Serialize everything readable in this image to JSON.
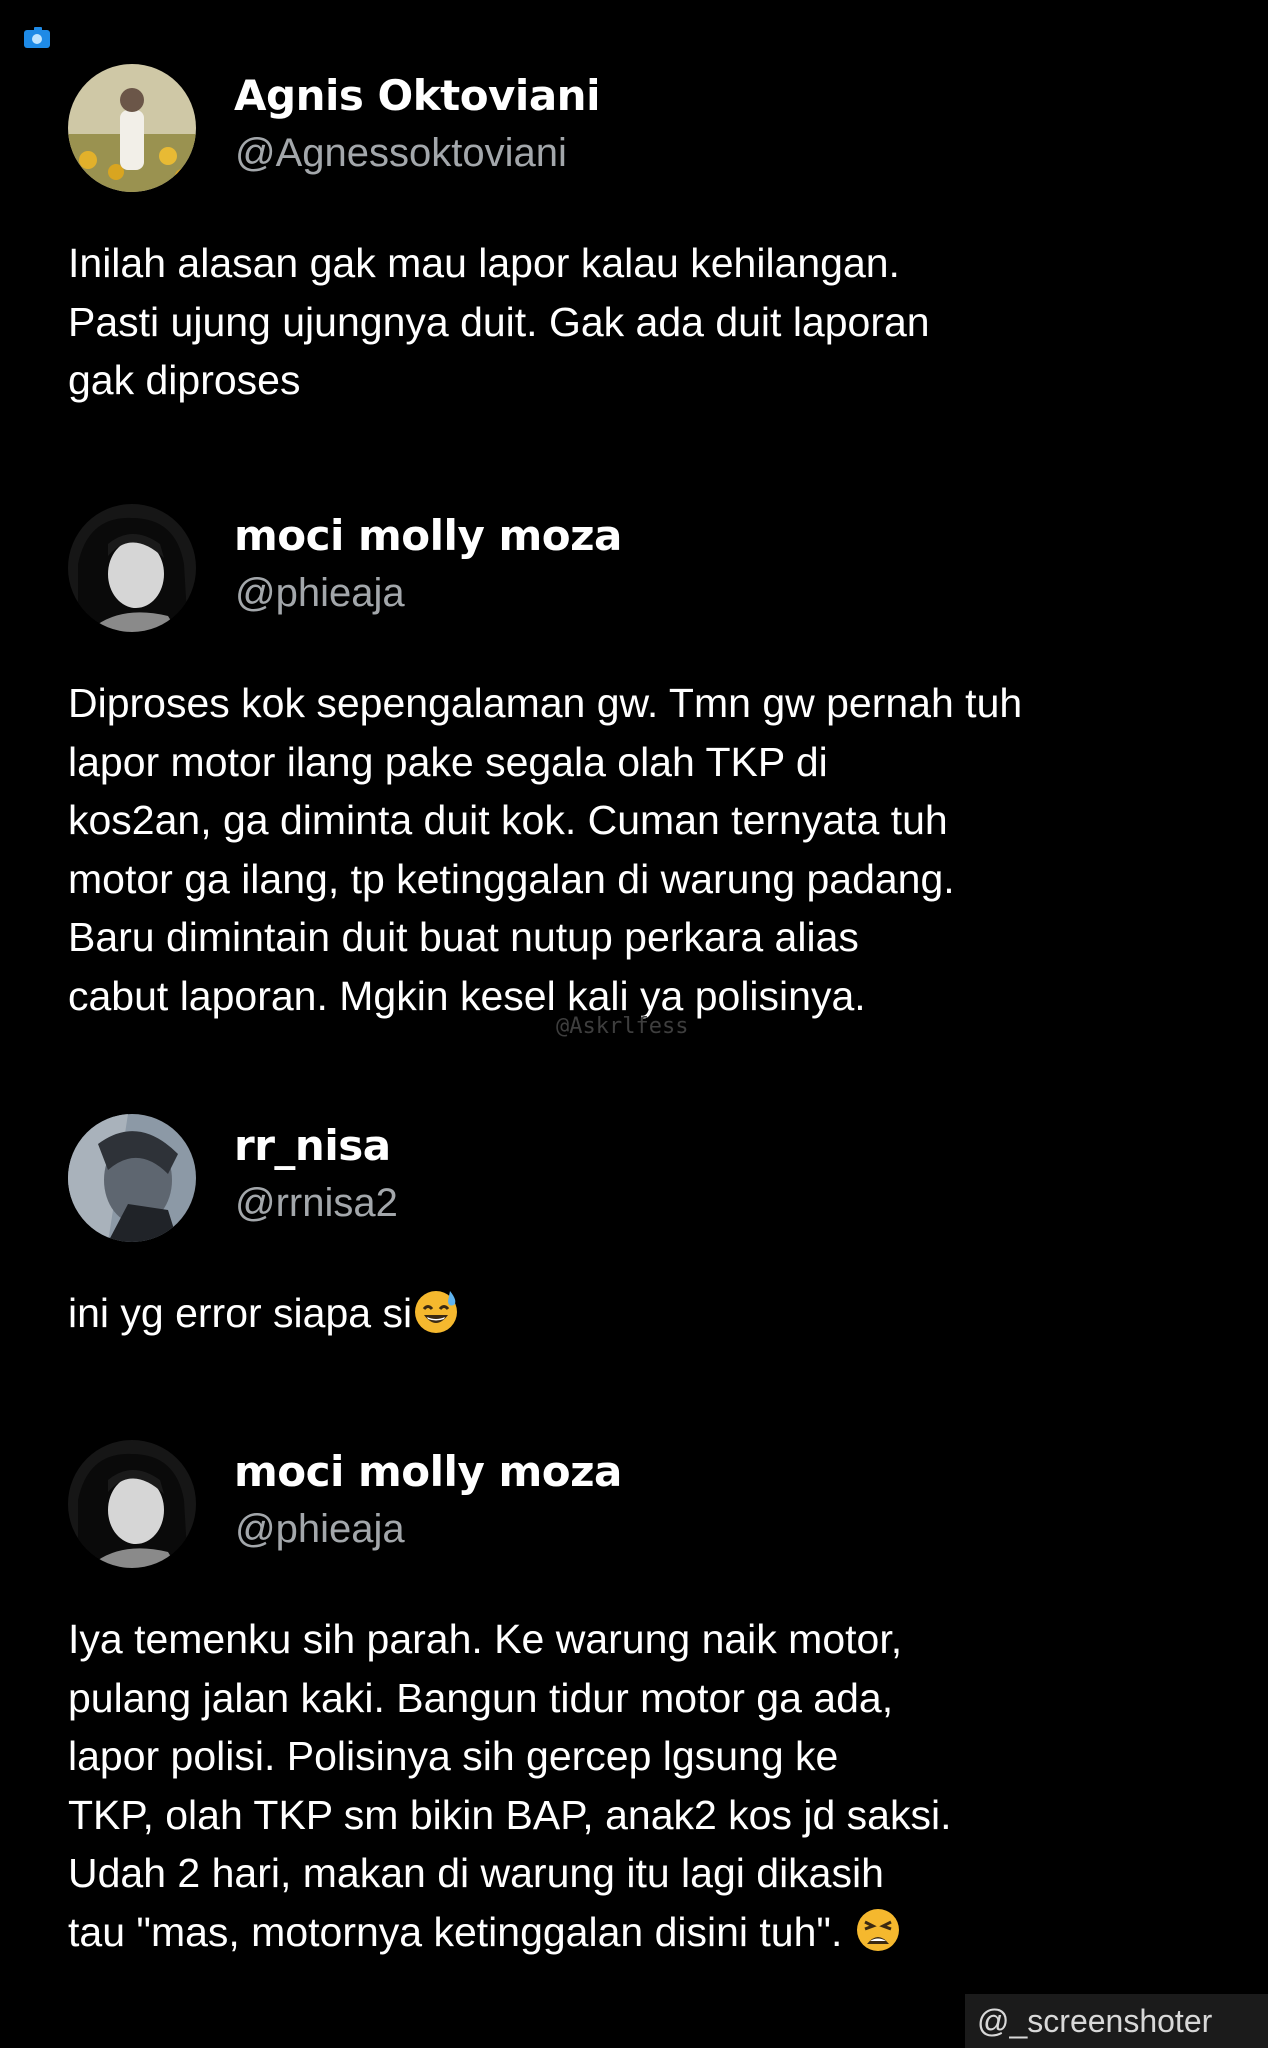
{
  "tweets": [
    {
      "display_name": "Agnis Oktoviani",
      "handle": "@Agnessoktoviani",
      "avatar_icon": "profile-photo-sunflower-field",
      "text": "Inilah alasan gak mau lapor kalau kehilangan.\nPasti ujung ujungnya duit. Gak ada duit laporan\ngak diproses"
    },
    {
      "display_name": "moci molly moza",
      "handle": "@phieaja",
      "avatar_icon": "profile-photo-grayscale",
      "text": "Diproses kok sepengalaman gw. Tmn gw pernah tuh\nlapor motor ilang pake segala olah TKP di\nkos2an, ga diminta duit kok. Cuman ternyata tuh\nmotor ga ilang, tp ketinggalan di warung padang.\nBaru dimintain duit buat nutup perkara alias\ncabut laporan. Mgkin kesel kali ya polisinya."
    },
    {
      "display_name": "rr_nisa",
      "handle": "@rrnisa2",
      "avatar_icon": "profile-photo-muted",
      "text": "ini yg error siapa si",
      "trailing_emoji": "grinning-sweat-emoji"
    },
    {
      "display_name": "moci molly moza",
      "handle": "@phieaja",
      "avatar_icon": "profile-photo-grayscale",
      "text": "Iya temenku sih parah. Ke warung naik motor,\npulang jalan kaki. Bangun tidur motor ga ada,\nlapor polisi. Polisinya sih gercep lgsung ke\nTKP, olah TKP sm bikin BAP, anak2 kos jd saksi.\nUdah 2 hari, makan di warung itu lagi dikasih\ntau \"mas, motornya ketinggalan disini tuh\". ",
      "trailing_emoji": "weary-face-emoji"
    }
  ],
  "watermark_center": "@Askrlfess",
  "watermark_corner": "@_screenshoter",
  "colors": {
    "background": "#000000",
    "text": "#ffffff",
    "handle": "#a3a7ab",
    "emoji_yellow": "#f5b82e"
  }
}
